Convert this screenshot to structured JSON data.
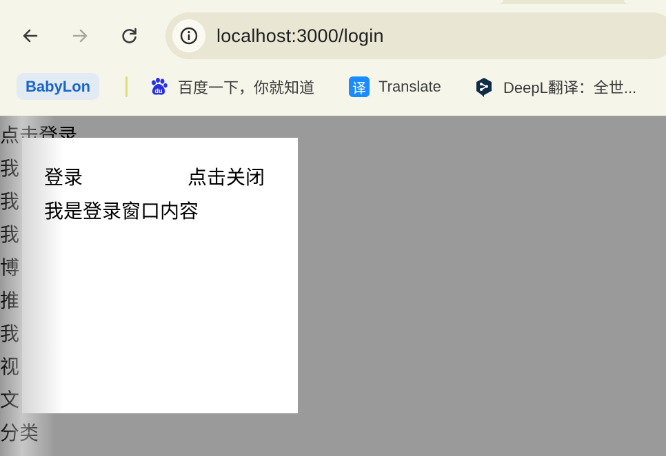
{
  "browser": {
    "url": "localhost:3000/login",
    "bookmarks": [
      {
        "label": "BabyLon",
        "icon": "babylon-chip"
      },
      {
        "label": "百度一下，你就知道",
        "icon": "baidu-icon"
      },
      {
        "label": "Translate",
        "icon": "translate-icon",
        "badge": "译"
      },
      {
        "label": "DeepL翻译：全世...",
        "icon": "deepl-icon"
      }
    ],
    "colors": {
      "accent": "#1a64c8",
      "chrome_bg": "#f6f5ea",
      "omnibox_bg": "#e9e7d3"
    }
  },
  "page": {
    "links": [
      "点击登录",
      "我",
      "我",
      "我",
      "博",
      "推",
      "我",
      "视",
      "文",
      "分类"
    ],
    "overlay_color": "#9a9a9a"
  },
  "modal": {
    "title": "登录",
    "close_label": "点击关闭",
    "content": "我是登录窗口内容"
  }
}
